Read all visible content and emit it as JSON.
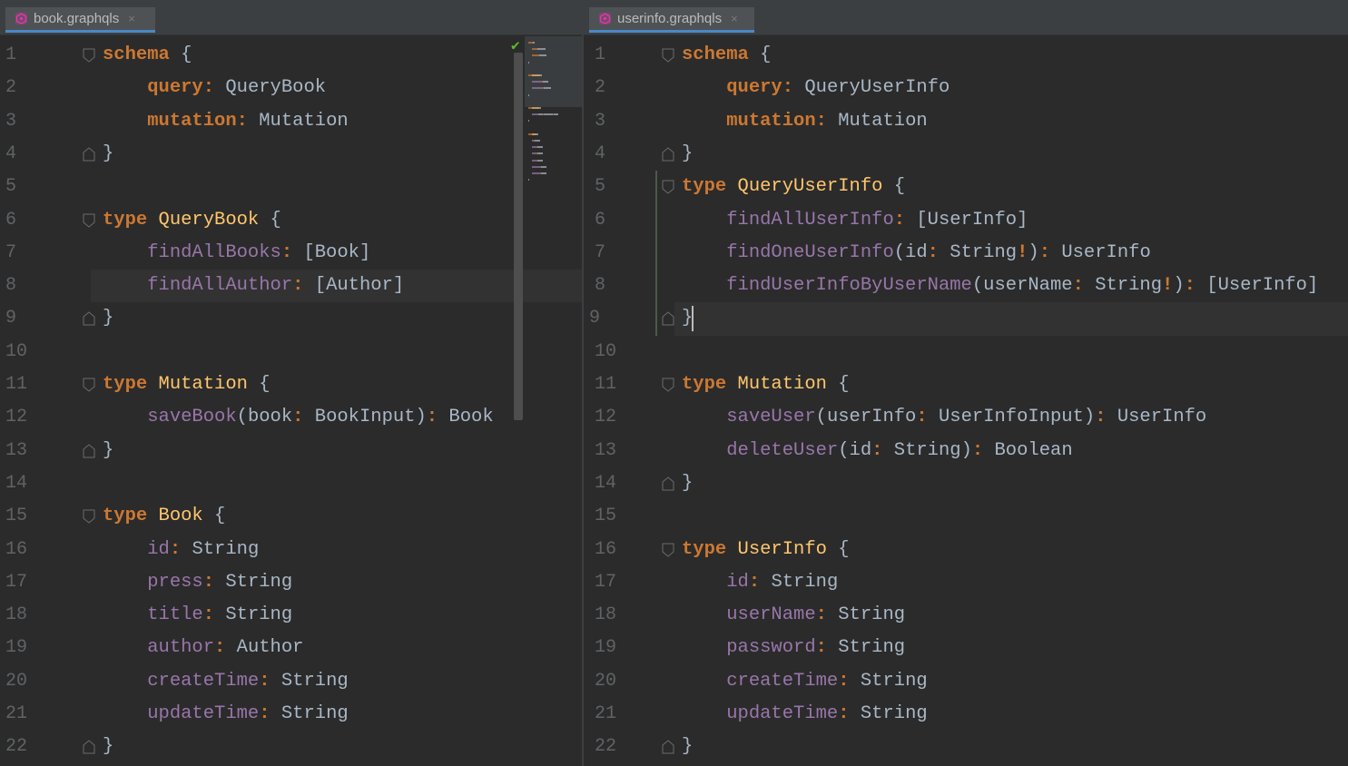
{
  "left": {
    "tab": {
      "label": "book.graphqls",
      "icon": "graphql-file-icon",
      "close": "×"
    },
    "lines": [
      [
        [
          "kw",
          "schema"
        ],
        [
          "br",
          " {"
        ]
      ],
      [
        [
          "sp",
          "    "
        ],
        [
          "kw",
          "query"
        ],
        [
          "kw",
          ":"
        ],
        [
          "br",
          " QueryBook"
        ]
      ],
      [
        [
          "sp",
          "    "
        ],
        [
          "kw",
          "mutation"
        ],
        [
          "kw",
          ":"
        ],
        [
          "br",
          " Mutation"
        ]
      ],
      [
        [
          "br",
          "}"
        ]
      ],
      [],
      [
        [
          "kw",
          "type"
        ],
        [
          "tn",
          " QueryBook"
        ],
        [
          "br",
          " {"
        ]
      ],
      [
        [
          "sp",
          "    "
        ],
        [
          "fld",
          "findAllBooks"
        ],
        [
          "kw",
          ":"
        ],
        [
          "br",
          " [Book]"
        ]
      ],
      [
        [
          "sp",
          "    "
        ],
        [
          "fld",
          "findAllAuthor"
        ],
        [
          "kw",
          ":"
        ],
        [
          "br",
          " [Author]"
        ]
      ],
      [
        [
          "br",
          "}"
        ]
      ],
      [],
      [
        [
          "kw",
          "type"
        ],
        [
          "tn",
          " Mutation"
        ],
        [
          "br",
          " {"
        ]
      ],
      [
        [
          "sp",
          "    "
        ],
        [
          "fld",
          "saveBook"
        ],
        [
          "br",
          "(book"
        ],
        [
          "kw",
          ":"
        ],
        [
          "br",
          " BookInput)"
        ],
        [
          "kw",
          ":"
        ],
        [
          "br",
          " Book"
        ]
      ],
      [
        [
          "br",
          "}"
        ]
      ],
      [],
      [
        [
          "kw",
          "type"
        ],
        [
          "tn",
          " Book"
        ],
        [
          "br",
          " {"
        ]
      ],
      [
        [
          "sp",
          "    "
        ],
        [
          "fld",
          "id"
        ],
        [
          "kw",
          ":"
        ],
        [
          "br",
          " String"
        ]
      ],
      [
        [
          "sp",
          "    "
        ],
        [
          "fld",
          "press"
        ],
        [
          "kw",
          ":"
        ],
        [
          "br",
          " String"
        ]
      ],
      [
        [
          "sp",
          "    "
        ],
        [
          "fld",
          "title"
        ],
        [
          "kw",
          ":"
        ],
        [
          "br",
          " String"
        ]
      ],
      [
        [
          "sp",
          "    "
        ],
        [
          "fld",
          "author"
        ],
        [
          "kw",
          ":"
        ],
        [
          "br",
          " Author"
        ]
      ],
      [
        [
          "sp",
          "    "
        ],
        [
          "fld",
          "createTime"
        ],
        [
          "kw",
          ":"
        ],
        [
          "br",
          " String"
        ]
      ],
      [
        [
          "sp",
          "    "
        ],
        [
          "fld",
          "updateTime"
        ],
        [
          "kw",
          ":"
        ],
        [
          "br",
          " String"
        ]
      ],
      [
        [
          "br",
          "}"
        ]
      ]
    ],
    "fold_open": [
      1,
      6,
      11,
      15
    ],
    "fold_close": [
      4,
      9,
      13,
      22
    ],
    "highlight_line": 8
  },
  "right": {
    "tab": {
      "label": "userinfo.graphqls",
      "icon": "graphql-file-icon",
      "close": "×"
    },
    "lines": [
      [
        [
          "kw",
          "schema"
        ],
        [
          "br",
          " {"
        ]
      ],
      [
        [
          "sp",
          "    "
        ],
        [
          "kw",
          "query"
        ],
        [
          "kw",
          ":"
        ],
        [
          "br",
          " QueryUserInfo"
        ]
      ],
      [
        [
          "sp",
          "    "
        ],
        [
          "kw",
          "mutation"
        ],
        [
          "kw",
          ":"
        ],
        [
          "br",
          " Mutation"
        ]
      ],
      [
        [
          "br",
          "}"
        ]
      ],
      [
        [
          "kw",
          "type"
        ],
        [
          "tn",
          " QueryUserInfo"
        ],
        [
          "br",
          " {"
        ]
      ],
      [
        [
          "sp",
          "    "
        ],
        [
          "fld",
          "findAllUserInfo"
        ],
        [
          "kw",
          ":"
        ],
        [
          "br",
          " [UserInfo]"
        ]
      ],
      [
        [
          "sp",
          "    "
        ],
        [
          "fld",
          "findOneUserInfo"
        ],
        [
          "br",
          "(id"
        ],
        [
          "kw",
          ":"
        ],
        [
          "br",
          " String"
        ],
        [
          "kw",
          "!"
        ],
        [
          "br",
          ")"
        ],
        [
          "kw",
          ":"
        ],
        [
          "br",
          " UserInfo"
        ]
      ],
      [
        [
          "sp",
          "    "
        ],
        [
          "fld",
          "findUserInfoByUserName"
        ],
        [
          "br",
          "(userName"
        ],
        [
          "kw",
          ":"
        ],
        [
          "br",
          " String"
        ],
        [
          "kw",
          "!"
        ],
        [
          "br",
          ")"
        ],
        [
          "kw",
          ":"
        ],
        [
          "br",
          " [UserInfo]"
        ]
      ],
      [
        [
          "br",
          "}"
        ]
      ],
      [],
      [
        [
          "kw",
          "type"
        ],
        [
          "tn",
          " Mutation"
        ],
        [
          "br",
          " {"
        ]
      ],
      [
        [
          "sp",
          "    "
        ],
        [
          "fld",
          "saveUser"
        ],
        [
          "br",
          "(userInfo"
        ],
        [
          "kw",
          ":"
        ],
        [
          "br",
          " UserInfoInput)"
        ],
        [
          "kw",
          ":"
        ],
        [
          "br",
          " UserInfo"
        ]
      ],
      [
        [
          "sp",
          "    "
        ],
        [
          "fld",
          "deleteUser"
        ],
        [
          "br",
          "(id"
        ],
        [
          "kw",
          ":"
        ],
        [
          "br",
          " String)"
        ],
        [
          "kw",
          ":"
        ],
        [
          "br",
          " Boolean"
        ]
      ],
      [
        [
          "br",
          "}"
        ]
      ],
      [],
      [
        [
          "kw",
          "type"
        ],
        [
          "tn",
          " UserInfo"
        ],
        [
          "br",
          " {"
        ]
      ],
      [
        [
          "sp",
          "    "
        ],
        [
          "fld",
          "id"
        ],
        [
          "kw",
          ":"
        ],
        [
          "br",
          " String"
        ]
      ],
      [
        [
          "sp",
          "    "
        ],
        [
          "fld",
          "userName"
        ],
        [
          "kw",
          ":"
        ],
        [
          "br",
          " String"
        ]
      ],
      [
        [
          "sp",
          "    "
        ],
        [
          "fld",
          "password"
        ],
        [
          "kw",
          ":"
        ],
        [
          "br",
          " String"
        ]
      ],
      [
        [
          "sp",
          "    "
        ],
        [
          "fld",
          "createTime"
        ],
        [
          "kw",
          ":"
        ],
        [
          "br",
          " String"
        ]
      ],
      [
        [
          "sp",
          "    "
        ],
        [
          "fld",
          "updateTime"
        ],
        [
          "kw",
          ":"
        ],
        [
          "br",
          " String"
        ]
      ],
      [
        [
          "br",
          "}"
        ]
      ]
    ],
    "fold_open": [
      1,
      5,
      11,
      16
    ],
    "fold_close": [
      4,
      9,
      14,
      22
    ],
    "highlight_line": 9
  },
  "inspection_ok_icon": "checkmark-icon",
  "colors": {
    "background": "#2b2b2b",
    "keyword": "#cc7832",
    "type_name": "#ffc66d",
    "field": "#9876aa",
    "text": "#a9b7c6",
    "line_number": "#606366",
    "caret_line": "#323232"
  }
}
